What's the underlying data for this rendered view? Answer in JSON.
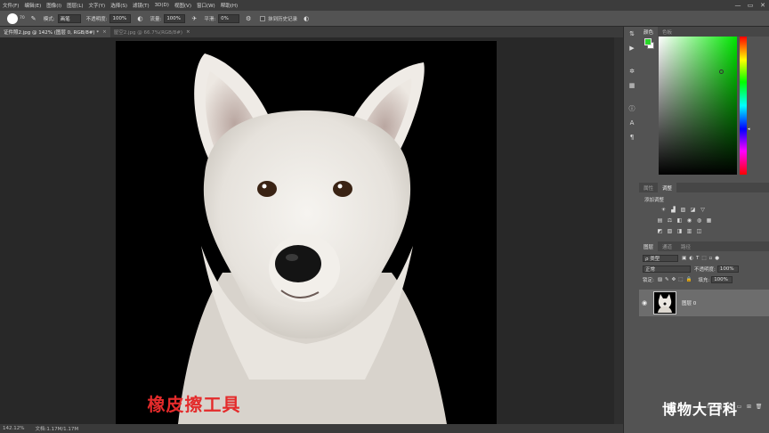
{
  "menubar": {
    "items": [
      "文件(F)",
      "编辑(E)",
      "图像(I)",
      "图层(L)",
      "文字(Y)",
      "选择(S)",
      "滤镜(T)",
      "3D(D)",
      "视图(V)",
      "窗口(W)",
      "帮助(H)"
    ],
    "win_min": "—",
    "win_max": "▭",
    "win_close": "✕"
  },
  "options": {
    "brush_size": "70",
    "mode_label": "模式:",
    "mode_value": "画笔",
    "opacity_label": "不透明度:",
    "opacity_value": "100%",
    "flow_label": "流量:",
    "flow_value": "100%",
    "smooth_label": "平滑:",
    "smooth_value": "0%",
    "history_label": "抹到历史记录"
  },
  "tabs": [
    {
      "label": "证件照2.jpg @ 142% (图层 0, RGB/8#) *",
      "active": true
    },
    {
      "label": "屋空2.jpg @ 66.7%(RGB/8#)",
      "active": false
    }
  ],
  "canvas": {
    "caption": "橡皮擦工具"
  },
  "status": {
    "zoom": "142.12%",
    "doc": "文档:1.17M/1.17M"
  },
  "color_panel": {
    "tabs": [
      "颜色",
      "色板"
    ],
    "fg_color": "#2ad52a",
    "bg_color": "#ffffff"
  },
  "adjust_panel": {
    "tabs": [
      "属性",
      "调整"
    ],
    "title": "添加调整"
  },
  "layers_panel": {
    "tabs": [
      "图层",
      "通道",
      "路径"
    ],
    "filter_value": "ρ 类型",
    "blend_value": "正常",
    "opacity_label": "不透明度:",
    "opacity_value": "100%",
    "lock_label": "锁定:",
    "fill_label": "填充:",
    "fill_value": "100%",
    "layer_name": "图层 0"
  },
  "watermark": "博物大百科"
}
